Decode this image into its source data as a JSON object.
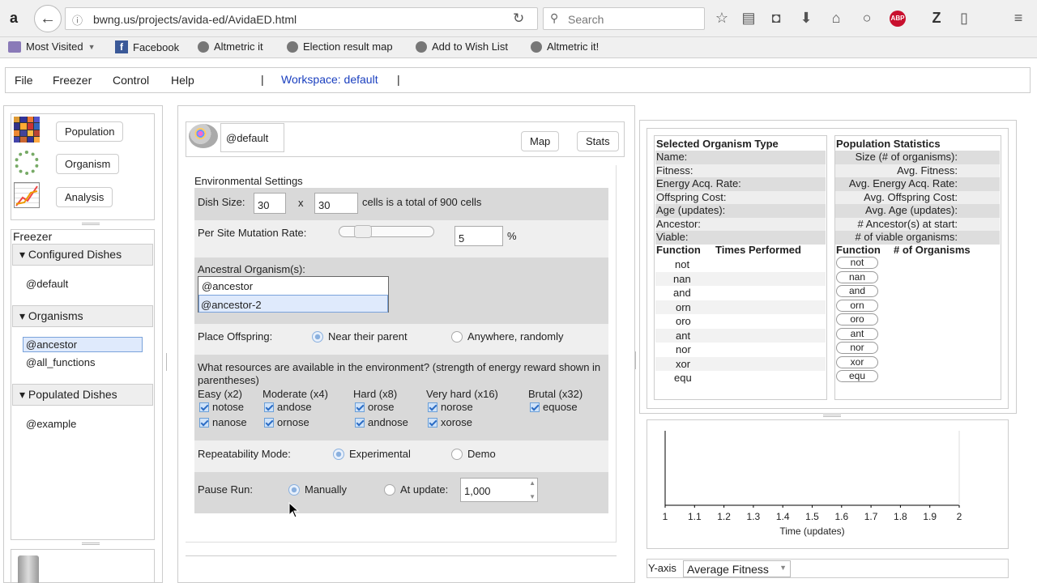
{
  "browser": {
    "url": "bwng.us/projects/avida-ed/AvidaED.html",
    "search_placeholder": "Search",
    "bookmarks": [
      "Most Visited",
      "Facebook",
      "Altmetric it",
      "Election result map",
      "Add to Wish List",
      "Altmetric it!"
    ]
  },
  "menu": {
    "items": [
      "File",
      "Freezer",
      "Control",
      "Help"
    ],
    "separator": "|",
    "workspace": "Workspace: default"
  },
  "nav": {
    "population": "Population",
    "organism": "Organism",
    "analysis": "Analysis"
  },
  "freezer": {
    "title": "Freezer",
    "configured_header": "Configured Dishes",
    "configured": [
      "@default"
    ],
    "organisms_header": "Organisms",
    "organisms": [
      "@ancestor",
      "@all_functions"
    ],
    "populated_header": "Populated Dishes",
    "populated": [
      "@example"
    ]
  },
  "center": {
    "dish_name": "@default",
    "map_btn": "Map",
    "stats_btn": "Stats",
    "env_title": "Environmental Settings",
    "dish_size_label": "Dish Size:",
    "dish_w": "30",
    "dish_x": "x",
    "dish_h": "30",
    "dish_total": "cells is a total of 900 cells",
    "mutation_label": "Per Site Mutation Rate:",
    "mutation_value": "5",
    "mutation_unit": "%",
    "mutation_slider_level": 0.19,
    "ancestral_label": "Ancestral Organism(s):",
    "ancestors": [
      "@ancestor",
      "@ancestor-2"
    ],
    "place_label": "Place Offspring:",
    "place_near": "Near their parent",
    "place_any": "Anywhere, randomly",
    "resources_question": "What resources are available in the environment? (strength of energy reward shown in parentheses)",
    "res_headers": [
      "Easy (x2)",
      "Moderate (x4)",
      "Hard (x8)",
      "Very hard (x16)",
      "Brutal (x32)"
    ],
    "res_row1": [
      "notose",
      "andose",
      "orose",
      "norose",
      "equose"
    ],
    "res_row2": [
      "nanose",
      "ornose",
      "andnose",
      "xorose"
    ],
    "repeat_label": "Repeatability Mode:",
    "repeat_exp": "Experimental",
    "repeat_demo": "Demo",
    "pause_label": "Pause Run:",
    "pause_manual": "Manually",
    "pause_at": "At update:",
    "pause_value": "1,000"
  },
  "org_panel": {
    "title": "Selected Organism Type",
    "fields": [
      "Name:",
      "Fitness:",
      "Energy Acq. Rate:",
      "Offspring Cost:",
      "Age (updates):",
      "Ancestor:",
      "Viable:"
    ],
    "col1": "Function",
    "col2": "Times Performed",
    "functions": [
      "not",
      "nan",
      "and",
      "orn",
      "oro",
      "ant",
      "nor",
      "xor",
      "equ"
    ]
  },
  "pop_panel": {
    "title": "Population Statistics",
    "fields": [
      "Size (# of organisms):",
      "Avg. Fitness:",
      "Avg. Energy Acq. Rate:",
      "Avg. Offspring Cost:",
      "Avg. Age (updates):",
      "# Ancestor(s) at start:",
      "# of viable organisms:"
    ],
    "col1": "Function",
    "col2": "# of Organisms",
    "functions": [
      "not",
      "nan",
      "and",
      "orn",
      "oro",
      "ant",
      "nor",
      "xor",
      "equ"
    ]
  },
  "chart_data": {
    "type": "line",
    "x_ticks": [
      "1",
      "1.1",
      "1.2",
      "1.3",
      "1.4",
      "1.5",
      "1.6",
      "1.7",
      "1.8",
      "1.9",
      "2"
    ],
    "xlabel": "Time (updates)",
    "ylabel": "",
    "xlim": [
      1,
      2
    ],
    "series": []
  },
  "yaxis": {
    "label": "Y-axis",
    "value": "Average Fitness"
  }
}
